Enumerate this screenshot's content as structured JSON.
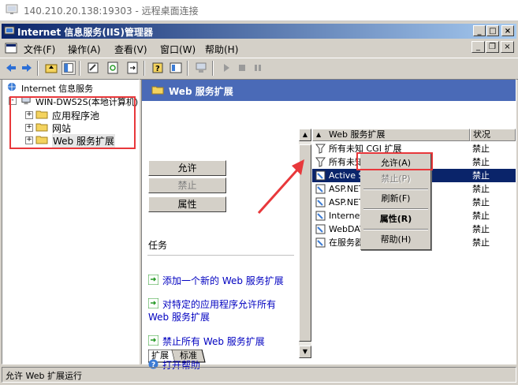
{
  "rdp": {
    "title": "140.210.20.138:19303 - 远程桌面连接"
  },
  "window": {
    "title": "Internet 信息服务(IIS)管理器"
  },
  "menu": {
    "file": "文件(F)",
    "action": "操作(A)",
    "view": "查看(V)",
    "window": "窗口(W)",
    "help": "帮助(H)"
  },
  "tree": {
    "root": "Internet 信息服务",
    "server": "WIN-DWS2S(本地计算机)",
    "app_pools": "应用程序池",
    "websites": "网站",
    "web_ext": "Web 服务扩展"
  },
  "panel": {
    "title": "Web 服务扩展",
    "allow_btn": "允许",
    "forbid_btn": "禁止",
    "props_btn": "属性",
    "tasks_label": "任务",
    "task1": "添加一个新的 Web 服务扩展",
    "task2_line1": "对特定的应用程序允许所有",
    "task2_line2": "Web 服务扩展",
    "task3": "禁止所有 Web 服务扩展",
    "task4": "打开帮助",
    "col_name": "Web 服务扩展",
    "col_status": "状况",
    "rows": [
      {
        "name": "所有未知 CGI 扩展",
        "status": "禁止"
      },
      {
        "name": "所有未知 ISAPI 扩展",
        "status": "禁止"
      },
      {
        "name": "Active Server Pages",
        "status": "禁止"
      },
      {
        "name": "ASP.NET v1.1.4322",
        "status": "禁止"
      },
      {
        "name": "ASP.NET v2.0.50727",
        "status": "禁止"
      },
      {
        "name": "Internet 数据连接器",
        "status": "禁止"
      },
      {
        "name": "WebDAV",
        "status": "禁止"
      },
      {
        "name": "在服务器端的包含文件",
        "status": "禁止"
      }
    ],
    "tab_ext": "扩展",
    "tab_std": "标准"
  },
  "context_menu": {
    "allow": "允许(A)",
    "forbid": "禁止(P)",
    "refresh": "刷新(F)",
    "props": "属性(R)",
    "help": "帮助(H)"
  },
  "status": {
    "text": "允许 Web 扩展运行"
  },
  "colors": {
    "title_start": "#0a246a",
    "header_blue": "#4a6ab7",
    "selection": "#0a246a",
    "highlight_red": "#e8383b"
  }
}
